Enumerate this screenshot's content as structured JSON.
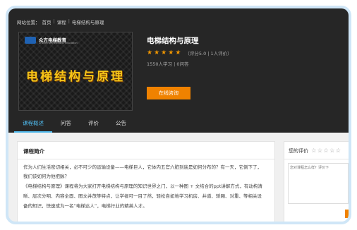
{
  "breadcrumb": {
    "prefix": "网站位置：",
    "items": [
      "首页",
      "课程",
      "电梯结构与原理"
    ],
    "separator": "|"
  },
  "cover": {
    "brand": "众方电梯教育",
    "brand_sub": "Zhong Fang Elevator Education",
    "title": "电梯结构与原理"
  },
  "course": {
    "title": "电梯结构与原理",
    "stars": 5,
    "rating_text": "（评分5.0 | 1人评价）",
    "meta": "1550人学习 | 0问答",
    "consult_label": "在线咨询"
  },
  "tabs": [
    "课程概述",
    "问答",
    "评价",
    "公告"
  ],
  "active_tab": 0,
  "intro": {
    "title": "课程简介",
    "paragraphs": [
      "作为人们生活密切相关，必不可少的运输设备——电梯巨人，它体内五官六脏到底是如何分布的？有一天，它倒下了，",
      "我们该如何为他把脉？",
      "《电梯结构与原理》课程将为大家打开电梯结构与原理的知识世界之门，以一种图 + 文结合的ppt讲解方式，有动构清",
      "晰、层次分明、内容全面、图文并茂等特点，让学者可一目了然，轻松自如地学习机房、井道、轿厢、对重、等相关设",
      "备的知识，快速成为一名“电梯达人”，电梯行业的精英人才。"
    ]
  },
  "my_rating": {
    "label": "您的评价",
    "placeholder": "您对课程怎么样？评价下",
    "empty_stars": 5
  },
  "colors": {
    "accent_orange": "#f08200",
    "star": "#f39800",
    "tab_active": "#4fb7e9",
    "dark_bg": "#262626"
  }
}
